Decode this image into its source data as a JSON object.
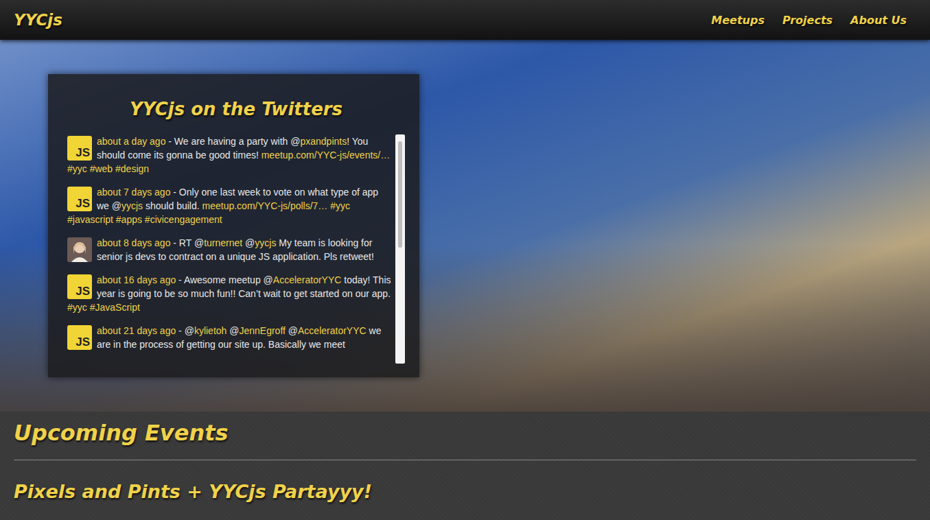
{
  "nav": {
    "logo": "YYCjs",
    "links": [
      {
        "label": "Meetups"
      },
      {
        "label": "Projects"
      },
      {
        "label": "About Us"
      }
    ]
  },
  "twitter": {
    "title": "YYCjs on the Twitters",
    "tweets": [
      {
        "kind": "logo",
        "avatar_text": "JS",
        "time": "about a day ago",
        "parts": [
          {
            "text": " - We are having a party with @",
            "link": false
          },
          {
            "text": "pxandpints",
            "link": true
          },
          {
            "text": "! You should come its gonna be good times! ",
            "link": false
          },
          {
            "text": "meetup.com/YYC-js/events/…",
            "link": true
          },
          {
            "text": " ",
            "link": false
          },
          {
            "text": "#yyc",
            "link": true
          },
          {
            "text": " ",
            "link": false
          },
          {
            "text": "#web",
            "link": true
          },
          {
            "text": " ",
            "link": false
          },
          {
            "text": "#design",
            "link": true
          }
        ]
      },
      {
        "kind": "logo",
        "avatar_text": "JS",
        "time": "about 7 days ago",
        "parts": [
          {
            "text": " - Only one last week to vote on what type of app we @",
            "link": false
          },
          {
            "text": "yycjs",
            "link": true
          },
          {
            "text": " should build. ",
            "link": false
          },
          {
            "text": "meetup.com/YYC-js/polls/7…",
            "link": true
          },
          {
            "text": " ",
            "link": false
          },
          {
            "text": "#yyc",
            "link": true
          },
          {
            "text": " ",
            "link": false
          },
          {
            "text": "#javascript",
            "link": true
          },
          {
            "text": " ",
            "link": false
          },
          {
            "text": "#apps",
            "link": true
          },
          {
            "text": " ",
            "link": false
          },
          {
            "text": "#civicengagement",
            "link": true
          }
        ]
      },
      {
        "kind": "photo",
        "avatar_text": "",
        "time": "about 8 days ago",
        "parts": [
          {
            "text": " - RT @",
            "link": false
          },
          {
            "text": "turnernet",
            "link": true
          },
          {
            "text": " @",
            "link": false
          },
          {
            "text": "yycjs",
            "link": true
          },
          {
            "text": " My team is looking for senior js devs to contract on a unique JS application. Pls retweet!",
            "link": false
          }
        ]
      },
      {
        "kind": "logo",
        "avatar_text": "JS",
        "time": "about 16 days ago",
        "parts": [
          {
            "text": " - Awesome meetup @",
            "link": false
          },
          {
            "text": "AcceleratorYYC",
            "link": true
          },
          {
            "text": " today! This year is going to be so much fun!! Can’t wait to get started on our app. ",
            "link": false
          },
          {
            "text": "#yyc",
            "link": true
          },
          {
            "text": " ",
            "link": false
          },
          {
            "text": "#JavaScript",
            "link": true
          }
        ]
      },
      {
        "kind": "logo",
        "avatar_text": "JS",
        "time": "about 21 days ago",
        "parts": [
          {
            "text": " - @",
            "link": false
          },
          {
            "text": "kylietoh",
            "link": true
          },
          {
            "text": " @",
            "link": false
          },
          {
            "text": "JennEgroff",
            "link": true
          },
          {
            "text": " @",
            "link": false
          },
          {
            "text": "AcceleratorYYC",
            "link": true
          },
          {
            "text": " we are in the process of getting our site up. Basically we meet",
            "link": false
          }
        ]
      }
    ]
  },
  "events": {
    "title": "Upcoming Events",
    "items": [
      {
        "title": "Pixels and Pints + YYCjs Partayyy!"
      }
    ]
  }
}
